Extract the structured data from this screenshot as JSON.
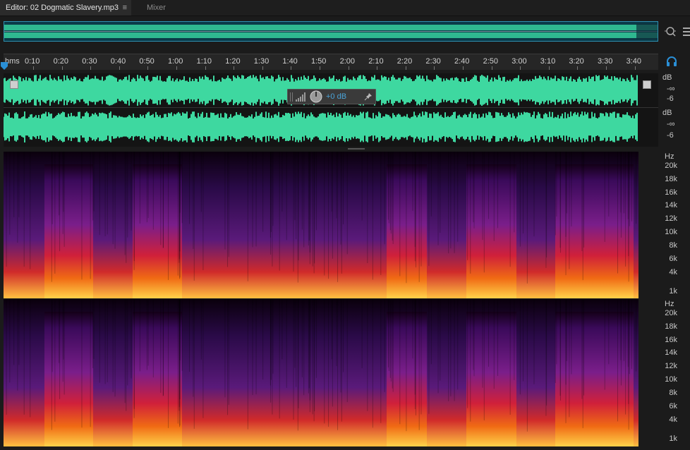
{
  "tabs": {
    "editor_label": "Editor: 02 Dogmatic Slavery.mp3",
    "editor_menu_glyph": "≡",
    "mixer_label": "Mixer"
  },
  "ruler": {
    "ticks": [
      "hms",
      "0:10",
      "0:20",
      "0:30",
      "0:40",
      "0:50",
      "1:00",
      "1:10",
      "1:20",
      "1:30",
      "1:40",
      "1:50",
      "2:00",
      "2:10",
      "2:20",
      "2:30",
      "2:40",
      "2:50",
      "3:00",
      "3:10",
      "3:20",
      "3:30",
      "3:40"
    ]
  },
  "waveform": {
    "db_unit": "dB",
    "db_neg_inf": "-∞",
    "db_minus6": "-6",
    "hud_value": "+0 dB",
    "color": "#3ed8a0"
  },
  "spectral": {
    "unit": "Hz",
    "labels": [
      "20k",
      "18k",
      "16k",
      "14k",
      "12k",
      "10k",
      "8k",
      "6k",
      "4k",
      "1k"
    ]
  },
  "icons": [
    "zoom-icon",
    "menu-icon",
    "headphones-icon",
    "playhead-icon",
    "volume-knob-icon",
    "pin-icon",
    "level-meter-icon"
  ]
}
